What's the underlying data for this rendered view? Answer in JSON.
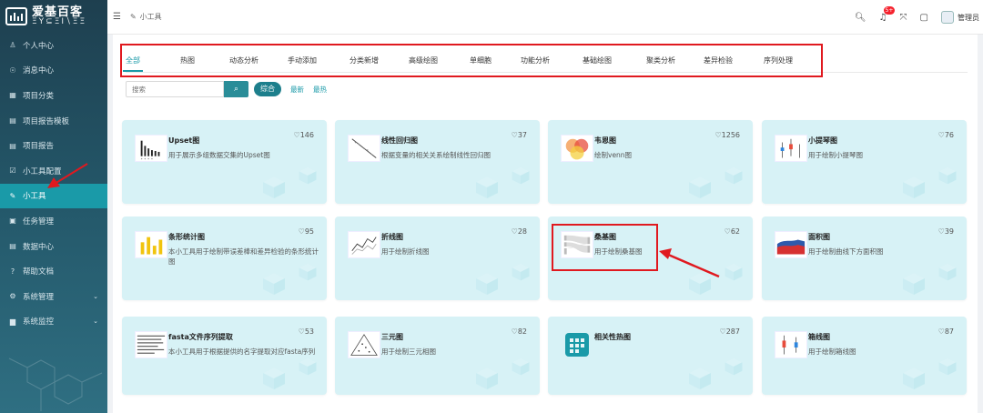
{
  "brand": {
    "line1": "爱基百客",
    "line2": "ΞΥ⊆ΞΙ∖ΞΞ"
  },
  "sidebar": {
    "items": [
      {
        "label": "个人中心",
        "icon": "user-icon",
        "glyph": "♙"
      },
      {
        "label": "消息中心",
        "icon": "message-icon",
        "glyph": "☉"
      },
      {
        "label": "项目分类",
        "icon": "grid-icon",
        "glyph": "▦"
      },
      {
        "label": "项目报告模板",
        "icon": "doc-icon",
        "glyph": "▤"
      },
      {
        "label": "项目报告",
        "icon": "report-icon",
        "glyph": "▤"
      },
      {
        "label": "小工具配置",
        "icon": "edit-icon",
        "glyph": "☑"
      },
      {
        "label": "小工具",
        "icon": "pencil-icon",
        "glyph": "✎"
      },
      {
        "label": "任务管理",
        "icon": "task-icon",
        "glyph": "▣"
      },
      {
        "label": "数据中心",
        "icon": "data-icon",
        "glyph": "▤"
      },
      {
        "label": "帮助文档",
        "icon": "help-icon",
        "glyph": "?"
      },
      {
        "label": "系统管理",
        "icon": "settings-icon",
        "glyph": "⚙"
      },
      {
        "label": "系统监控",
        "icon": "monitor-icon",
        "glyph": "▆"
      }
    ]
  },
  "topbar": {
    "breadcrumb": "小工具",
    "notification_count": "5+",
    "user": "管理员"
  },
  "tabs": [
    "全部",
    "热图",
    "动态分析",
    "手动添加",
    "分类新增",
    "高级绘图",
    "单细胞",
    "功能分析",
    "基础绘图",
    "聚类分析",
    "差异检验",
    "序列处理"
  ],
  "search": {
    "placeholder": "搜索",
    "sort_active": "综合",
    "sort_new": "最新",
    "sort_hot": "最热"
  },
  "cards": [
    {
      "title": "Upset图",
      "desc": "用于展示多组数据交集的Upset图",
      "likes": "146"
    },
    {
      "title": "线性回归图",
      "desc": "根据变量的相关关系绘制线性回归图",
      "likes": "37"
    },
    {
      "title": "韦恩图",
      "desc": "绘制venn图",
      "likes": "1256"
    },
    {
      "title": "小提琴图",
      "desc": "用于绘制小提琴图",
      "likes": "76"
    },
    {
      "title": "条形统计图",
      "desc": "本小工具用于绘制带误差棒和差异检验的条形统计图",
      "likes": "95"
    },
    {
      "title": "折线图",
      "desc": "用于绘制折线图",
      "likes": "28"
    },
    {
      "title": "桑基图",
      "desc": "用于绘制桑基图",
      "likes": "62"
    },
    {
      "title": "面积图",
      "desc": "用于绘制曲线下方面积图",
      "likes": "39"
    },
    {
      "title": "fasta文件序列提取",
      "desc": "本小工具用于根据提供的名字提取对应fasta序列",
      "likes": "53"
    },
    {
      "title": "三元图",
      "desc": "用于绘制三元相图",
      "likes": "82"
    },
    {
      "title": "相关性热图",
      "desc": "",
      "likes": "287"
    },
    {
      "title": "箱线图",
      "desc": "用于绘制箱线图",
      "likes": "87"
    }
  ],
  "colors": {
    "accent": "#1a9aa8",
    "sidebar": "#24586a",
    "card": "#d7f2f6",
    "annotation": "#e0191f"
  }
}
